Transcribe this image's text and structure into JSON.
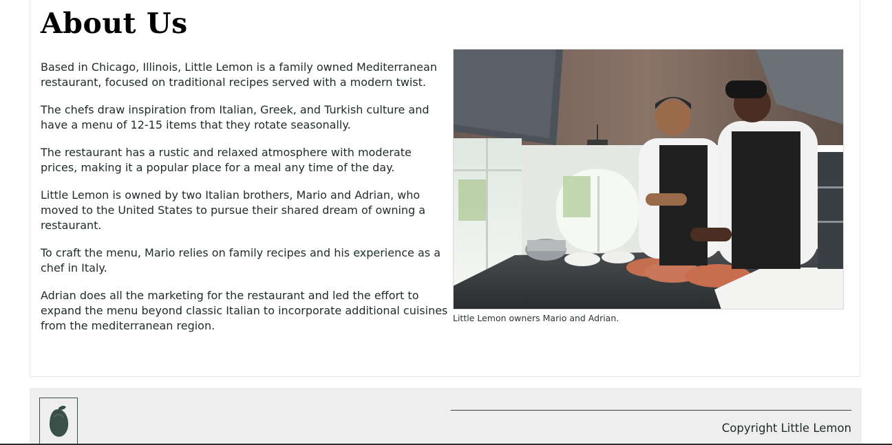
{
  "about": {
    "title": "About Us",
    "paragraphs": [
      "Based in Chicago, Illinois, Little Lemon is a family owned Mediterranean restaurant, focused on traditional recipes served with a modern twist.",
      "The chefs draw inspiration from Italian, Greek, and Turkish culture and have a menu of 12-15 items that they rotate seasonally.",
      "The restaurant has a rustic and relaxed atmosphere with moderate prices, making it a popular place for a meal any time of the day.",
      "Little Lemon is owned by two Italian brothers, Mario and Adrian, who moved to the United States to pursue their shared dream of owning a restaurant.",
      "To craft the menu, Mario relies on family recipes and his experience as a chef in Italy.",
      "Adrian does all the marketing for the restaurant and led the effort to expand the menu beyond classic Italian to incorporate additional cuisines from the mediterranean region."
    ],
    "photo_caption": "Little Lemon owners Mario and Adrian."
  },
  "footer": {
    "logo_icon": "lemon-logo-icon",
    "copyright": "Copyright Little Lemon"
  },
  "colors": {
    "footer_bg": "#edeeed",
    "logo_green": "#3a4f48"
  }
}
